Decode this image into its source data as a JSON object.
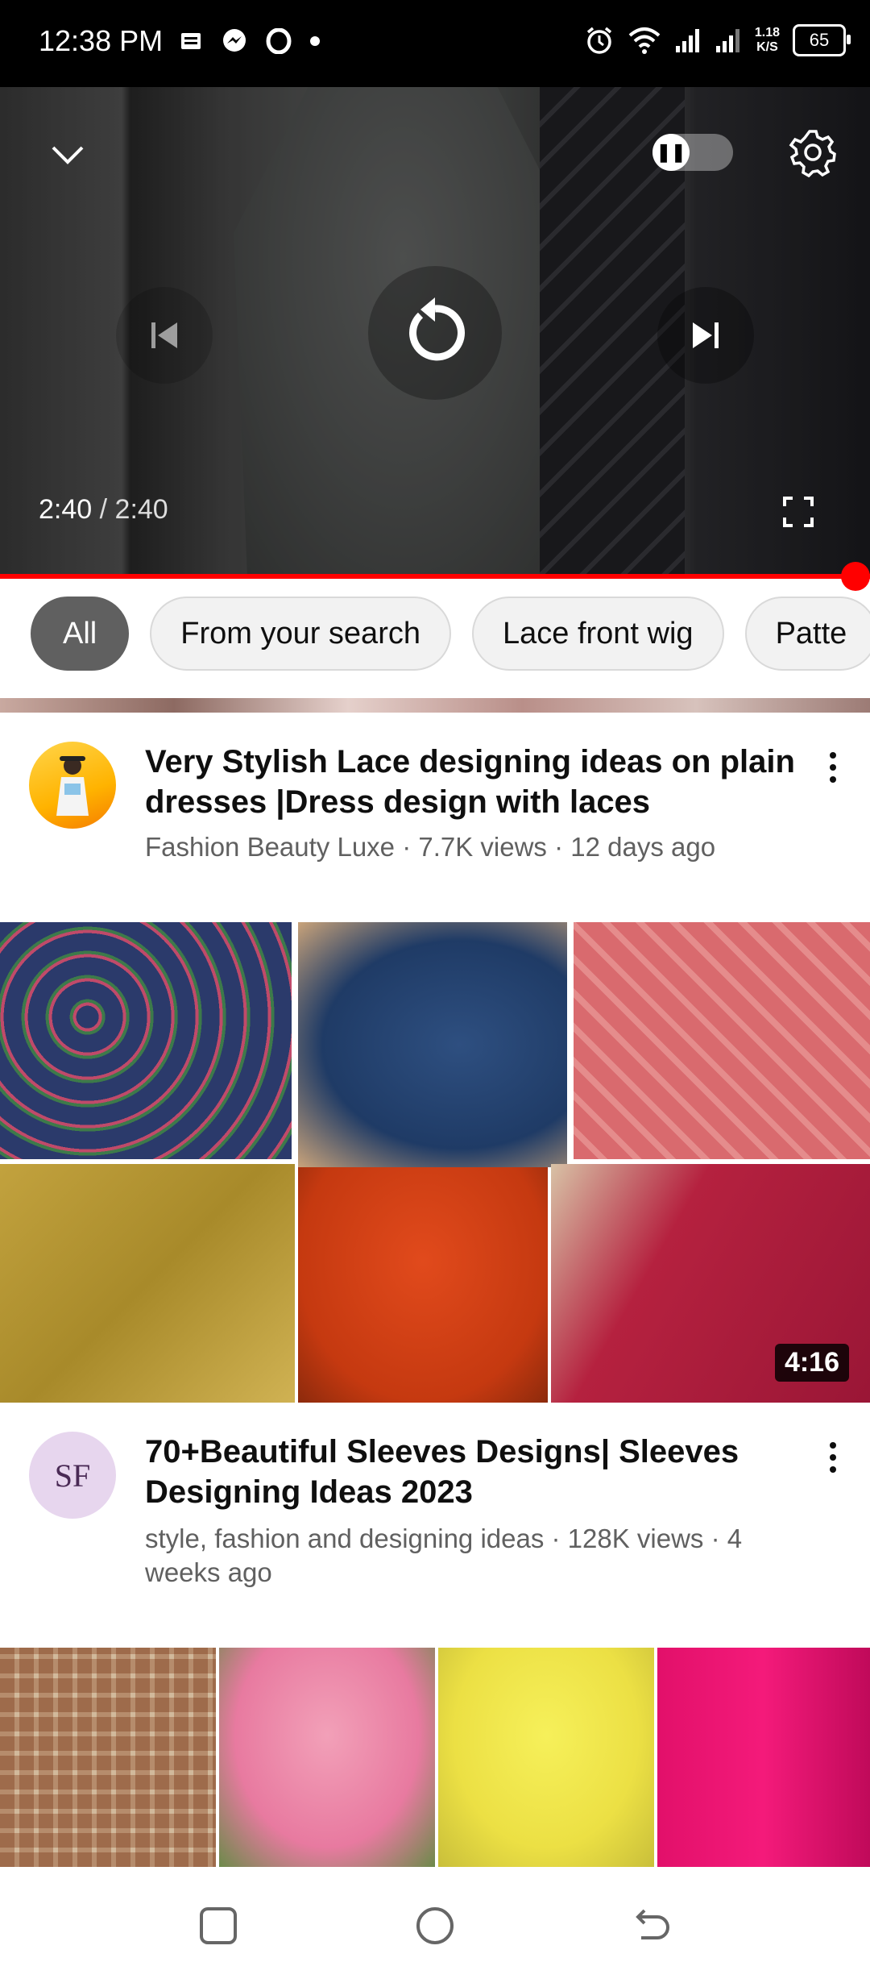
{
  "status_bar": {
    "time": "12:38 PM",
    "net_speed_value": "1.18",
    "net_speed_unit": "K/S",
    "battery": "65",
    "icons": [
      "notification-icon",
      "messenger-icon",
      "opera-icon",
      "dot-icon",
      "alarm-icon",
      "wifi-icon",
      "signal-icon",
      "signal-icon"
    ]
  },
  "player": {
    "current_time": "2:40",
    "separator": " / ",
    "duration": "2:40",
    "progress": 1.0,
    "icons": [
      "chevron-down-icon",
      "autoplay-toggle-icon",
      "settings-icon",
      "previous-icon",
      "replay-icon",
      "next-icon",
      "fullscreen-icon"
    ]
  },
  "chips": [
    {
      "label": "All",
      "active": true
    },
    {
      "label": "From your search",
      "active": false
    },
    {
      "label": "Lace front wig",
      "active": false
    },
    {
      "label": "Patte",
      "active": false
    }
  ],
  "videos": [
    {
      "title": "Very Stylish Lace designing ideas on plain dresses |Dress design with laces",
      "meta": "Fashion Beauty Luxe · 7.7K views · 12 days ago"
    },
    {
      "title": "70+Beautiful Sleeves Designs| Sleeves Designing Ideas 2023",
      "meta": "style, fashion and designing ideas · 128K views · 4 weeks ago",
      "duration": "4:16",
      "avatar_text": "SF"
    }
  ],
  "colors": {
    "progress": "#ff0000",
    "chip_active_bg": "#606060",
    "meta_text": "#606060"
  }
}
